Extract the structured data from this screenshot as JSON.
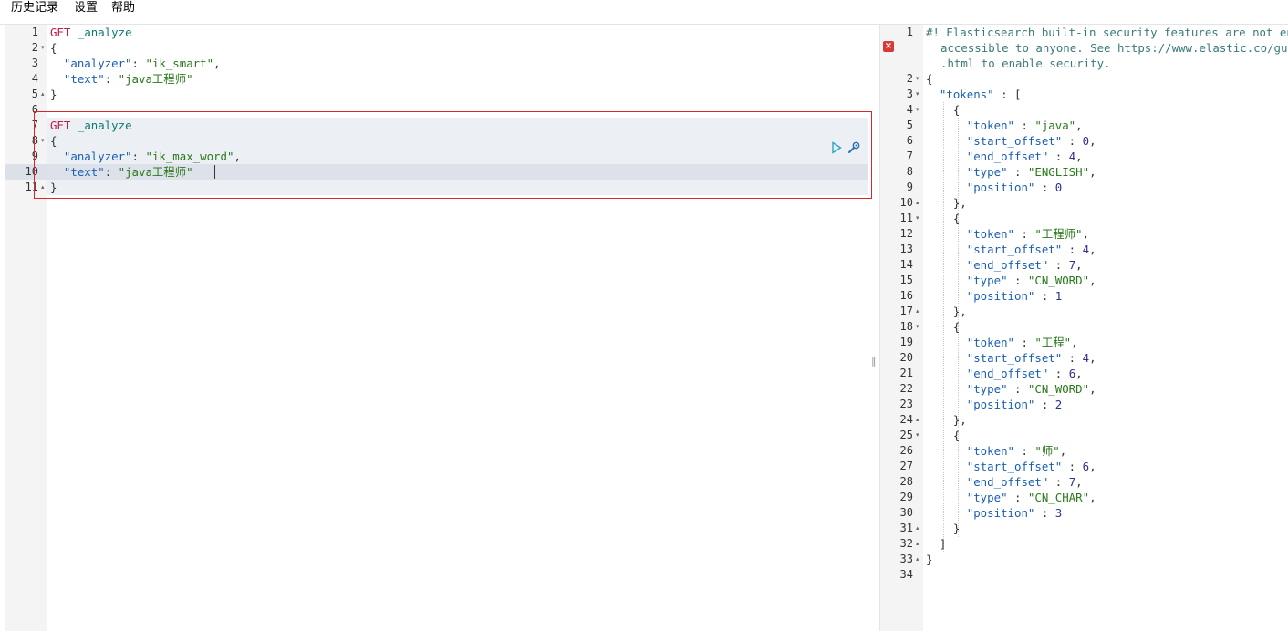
{
  "menu": {
    "history": "历史记录",
    "settings": "设置",
    "help": "帮助"
  },
  "request": {
    "lines": [
      {
        "n": "1",
        "fold": "",
        "segs": [
          [
            "m",
            "GET"
          ],
          [
            "p",
            " "
          ],
          [
            "u",
            "_analyze"
          ]
        ]
      },
      {
        "n": "2",
        "fold": "▾",
        "segs": [
          [
            "p",
            "{"
          ]
        ]
      },
      {
        "n": "3",
        "fold": "",
        "segs": [
          [
            "p",
            "  "
          ],
          [
            "k",
            "\"analyzer\""
          ],
          [
            "p",
            ": "
          ],
          [
            "s",
            "\"ik_smart\""
          ],
          [
            "p",
            ","
          ]
        ]
      },
      {
        "n": "4",
        "fold": "",
        "segs": [
          [
            "p",
            "  "
          ],
          [
            "k",
            "\"text\""
          ],
          [
            "p",
            ": "
          ],
          [
            "s",
            "\"java工程师\""
          ]
        ]
      },
      {
        "n": "5",
        "fold": "▴",
        "segs": [
          [
            "p",
            "}"
          ]
        ]
      },
      {
        "n": "6",
        "fold": "",
        "segs": []
      },
      {
        "n": "7",
        "fold": "",
        "segs": [
          [
            "m",
            "GET"
          ],
          [
            "p",
            " "
          ],
          [
            "u",
            "_analyze"
          ]
        ]
      },
      {
        "n": "8",
        "fold": "▾",
        "segs": [
          [
            "p",
            "{"
          ]
        ]
      },
      {
        "n": "9",
        "fold": "",
        "segs": [
          [
            "p",
            "  "
          ],
          [
            "k",
            "\"analyzer\""
          ],
          [
            "p",
            ": "
          ],
          [
            "s",
            "\"ik_max_word\""
          ],
          [
            "p",
            ","
          ]
        ]
      },
      {
        "n": "10",
        "fold": "",
        "segs": [
          [
            "p",
            "  "
          ],
          [
            "k",
            "\"text\""
          ],
          [
            "p",
            ": "
          ],
          [
            "s",
            "\"java工程师\""
          ]
        ]
      },
      {
        "n": "11",
        "fold": "▴",
        "segs": [
          [
            "p",
            "}"
          ]
        ]
      }
    ]
  },
  "response": {
    "comment_lines": [
      "#! Elasticsearch built-in security features are not enabled. Without authentication, your cluster could be",
      "accessible to anyone. See https://www.elastic.co/guide/en/elasticsearch/reference/7.14/security-minimal-setup",
      ".html to enable security."
    ],
    "lines": [
      {
        "n": "2",
        "fold": "▾",
        "segs": [
          [
            "p",
            "{"
          ]
        ]
      },
      {
        "n": "3",
        "fold": "▾",
        "segs": [
          [
            "p",
            "  "
          ],
          [
            "k",
            "\"tokens\""
          ],
          [
            "p",
            " : ["
          ]
        ]
      },
      {
        "n": "4",
        "fold": "▾",
        "segs": [
          [
            "p",
            "    {"
          ]
        ]
      },
      {
        "n": "5",
        "fold": "",
        "segs": [
          [
            "p",
            "      "
          ],
          [
            "k",
            "\"token\""
          ],
          [
            "p",
            " : "
          ],
          [
            "s",
            "\"java\""
          ],
          [
            "p",
            ","
          ]
        ]
      },
      {
        "n": "6",
        "fold": "",
        "segs": [
          [
            "p",
            "      "
          ],
          [
            "k",
            "\"start_offset\""
          ],
          [
            "p",
            " : "
          ],
          [
            "n",
            "0"
          ],
          [
            "p",
            ","
          ]
        ]
      },
      {
        "n": "7",
        "fold": "",
        "segs": [
          [
            "p",
            "      "
          ],
          [
            "k",
            "\"end_offset\""
          ],
          [
            "p",
            " : "
          ],
          [
            "n",
            "4"
          ],
          [
            "p",
            ","
          ]
        ]
      },
      {
        "n": "8",
        "fold": "",
        "segs": [
          [
            "p",
            "      "
          ],
          [
            "k",
            "\"type\""
          ],
          [
            "p",
            " : "
          ],
          [
            "s",
            "\"ENGLISH\""
          ],
          [
            "p",
            ","
          ]
        ]
      },
      {
        "n": "9",
        "fold": "",
        "segs": [
          [
            "p",
            "      "
          ],
          [
            "k",
            "\"position\""
          ],
          [
            "p",
            " : "
          ],
          [
            "n",
            "0"
          ]
        ]
      },
      {
        "n": "10",
        "fold": "▴",
        "segs": [
          [
            "p",
            "    },"
          ]
        ]
      },
      {
        "n": "11",
        "fold": "▾",
        "segs": [
          [
            "p",
            "    {"
          ]
        ]
      },
      {
        "n": "12",
        "fold": "",
        "segs": [
          [
            "p",
            "      "
          ],
          [
            "k",
            "\"token\""
          ],
          [
            "p",
            " : "
          ],
          [
            "s",
            "\"工程师\""
          ],
          [
            "p",
            ","
          ]
        ]
      },
      {
        "n": "13",
        "fold": "",
        "segs": [
          [
            "p",
            "      "
          ],
          [
            "k",
            "\"start_offset\""
          ],
          [
            "p",
            " : "
          ],
          [
            "n",
            "4"
          ],
          [
            "p",
            ","
          ]
        ]
      },
      {
        "n": "14",
        "fold": "",
        "segs": [
          [
            "p",
            "      "
          ],
          [
            "k",
            "\"end_offset\""
          ],
          [
            "p",
            " : "
          ],
          [
            "n",
            "7"
          ],
          [
            "p",
            ","
          ]
        ]
      },
      {
        "n": "15",
        "fold": "",
        "segs": [
          [
            "p",
            "      "
          ],
          [
            "k",
            "\"type\""
          ],
          [
            "p",
            " : "
          ],
          [
            "s",
            "\"CN_WORD\""
          ],
          [
            "p",
            ","
          ]
        ]
      },
      {
        "n": "16",
        "fold": "",
        "segs": [
          [
            "p",
            "      "
          ],
          [
            "k",
            "\"position\""
          ],
          [
            "p",
            " : "
          ],
          [
            "n",
            "1"
          ]
        ]
      },
      {
        "n": "17",
        "fold": "▴",
        "segs": [
          [
            "p",
            "    },"
          ]
        ]
      },
      {
        "n": "18",
        "fold": "▾",
        "segs": [
          [
            "p",
            "    {"
          ]
        ]
      },
      {
        "n": "19",
        "fold": "",
        "segs": [
          [
            "p",
            "      "
          ],
          [
            "k",
            "\"token\""
          ],
          [
            "p",
            " : "
          ],
          [
            "s",
            "\"工程\""
          ],
          [
            "p",
            ","
          ]
        ]
      },
      {
        "n": "20",
        "fold": "",
        "segs": [
          [
            "p",
            "      "
          ],
          [
            "k",
            "\"start_offset\""
          ],
          [
            "p",
            " : "
          ],
          [
            "n",
            "4"
          ],
          [
            "p",
            ","
          ]
        ]
      },
      {
        "n": "21",
        "fold": "",
        "segs": [
          [
            "p",
            "      "
          ],
          [
            "k",
            "\"end_offset\""
          ],
          [
            "p",
            " : "
          ],
          [
            "n",
            "6"
          ],
          [
            "p",
            ","
          ]
        ]
      },
      {
        "n": "22",
        "fold": "",
        "segs": [
          [
            "p",
            "      "
          ],
          [
            "k",
            "\"type\""
          ],
          [
            "p",
            " : "
          ],
          [
            "s",
            "\"CN_WORD\""
          ],
          [
            "p",
            ","
          ]
        ]
      },
      {
        "n": "23",
        "fold": "",
        "segs": [
          [
            "p",
            "      "
          ],
          [
            "k",
            "\"position\""
          ],
          [
            "p",
            " : "
          ],
          [
            "n",
            "2"
          ]
        ]
      },
      {
        "n": "24",
        "fold": "▴",
        "segs": [
          [
            "p",
            "    },"
          ]
        ]
      },
      {
        "n": "25",
        "fold": "▾",
        "segs": [
          [
            "p",
            "    {"
          ]
        ]
      },
      {
        "n": "26",
        "fold": "",
        "segs": [
          [
            "p",
            "      "
          ],
          [
            "k",
            "\"token\""
          ],
          [
            "p",
            " : "
          ],
          [
            "s",
            "\"师\""
          ],
          [
            "p",
            ","
          ]
        ]
      },
      {
        "n": "27",
        "fold": "",
        "segs": [
          [
            "p",
            "      "
          ],
          [
            "k",
            "\"start_offset\""
          ],
          [
            "p",
            " : "
          ],
          [
            "n",
            "6"
          ],
          [
            "p",
            ","
          ]
        ]
      },
      {
        "n": "28",
        "fold": "",
        "segs": [
          [
            "p",
            "      "
          ],
          [
            "k",
            "\"end_offset\""
          ],
          [
            "p",
            " : "
          ],
          [
            "n",
            "7"
          ],
          [
            "p",
            ","
          ]
        ]
      },
      {
        "n": "29",
        "fold": "",
        "segs": [
          [
            "p",
            "      "
          ],
          [
            "k",
            "\"type\""
          ],
          [
            "p",
            " : "
          ],
          [
            "s",
            "\"CN_CHAR\""
          ],
          [
            "p",
            ","
          ]
        ]
      },
      {
        "n": "30",
        "fold": "",
        "segs": [
          [
            "p",
            "      "
          ],
          [
            "k",
            "\"position\""
          ],
          [
            "p",
            " : "
          ],
          [
            "n",
            "3"
          ]
        ]
      },
      {
        "n": "31",
        "fold": "▴",
        "segs": [
          [
            "p",
            "    }"
          ]
        ]
      },
      {
        "n": "32",
        "fold": "▴",
        "segs": [
          [
            "p",
            "  ]"
          ]
        ]
      },
      {
        "n": "33",
        "fold": "▴",
        "segs": [
          [
            "p",
            "}"
          ]
        ]
      },
      {
        "n": "34",
        "fold": "",
        "segs": []
      }
    ]
  },
  "icons": {
    "run": "play-icon",
    "tools": "wrench-icon",
    "error": "error-icon",
    "resize": "resize-handle"
  },
  "colors": {
    "method": "#c41a48",
    "url": "#0b7a72",
    "key": "#1a5fb4",
    "string": "#2b7a1c",
    "number": "#2e3192",
    "highlight_border": "#d9262c"
  }
}
